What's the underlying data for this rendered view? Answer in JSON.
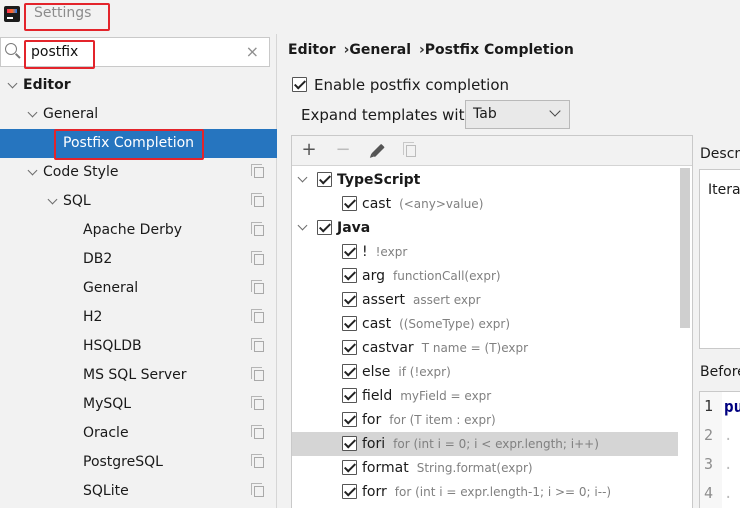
{
  "window": {
    "title": "Settings"
  },
  "search": {
    "value": "postfix",
    "clear_glyph": "×"
  },
  "sidebar": {
    "items": [
      {
        "label": "Editor"
      },
      {
        "label": "General"
      },
      {
        "label": "Postfix Completion"
      },
      {
        "label": "Code Style"
      },
      {
        "label": "SQL"
      },
      {
        "label": "Apache Derby"
      },
      {
        "label": "DB2"
      },
      {
        "label": "General"
      },
      {
        "label": "H2"
      },
      {
        "label": "HSQLDB"
      },
      {
        "label": "MS SQL Server"
      },
      {
        "label": "MySQL"
      },
      {
        "label": "Oracle"
      },
      {
        "label": "PostgreSQL"
      },
      {
        "label": "SQLite"
      }
    ]
  },
  "breadcrumb": {
    "items": [
      "Editor",
      "General",
      "Postfix Completion"
    ],
    "separator": "›"
  },
  "settings": {
    "enable_label": "Enable postfix completion",
    "enable_checked": true,
    "expand_label": "Expand templates with",
    "expand_value": "Tab"
  },
  "toolbar": {
    "add": "+",
    "remove": "−"
  },
  "templates": {
    "typescript": {
      "name": "TypeScript",
      "items": [
        {
          "key": "cast",
          "desc": "(<any>value)"
        }
      ]
    },
    "java": {
      "name": "Java",
      "items": [
        {
          "key": "!",
          "desc": "!expr"
        },
        {
          "key": "arg",
          "desc": "functionCall(expr)"
        },
        {
          "key": "assert",
          "desc": "assert expr"
        },
        {
          "key": "cast",
          "desc": "((SomeType) expr)"
        },
        {
          "key": "castvar",
          "desc": "T name = (T)expr"
        },
        {
          "key": "else",
          "desc": "if (!expr)"
        },
        {
          "key": "field",
          "desc": "myField = expr"
        },
        {
          "key": "for",
          "desc": "for (T item : expr)"
        },
        {
          "key": "fori",
          "desc": "for (int i = 0; i < expr.length; i++)"
        },
        {
          "key": "format",
          "desc": "String.format(expr)"
        },
        {
          "key": "forr",
          "desc": "for (int i = expr.length-1; i >= 0; i--)"
        }
      ]
    }
  },
  "description_panel": {
    "label": "Descrip",
    "text": "Iterat"
  },
  "before_panel": {
    "label": "Before",
    "code": "pu",
    "line_numbers": [
      "1",
      "2",
      "3",
      "4"
    ],
    "dots": ". ."
  }
}
